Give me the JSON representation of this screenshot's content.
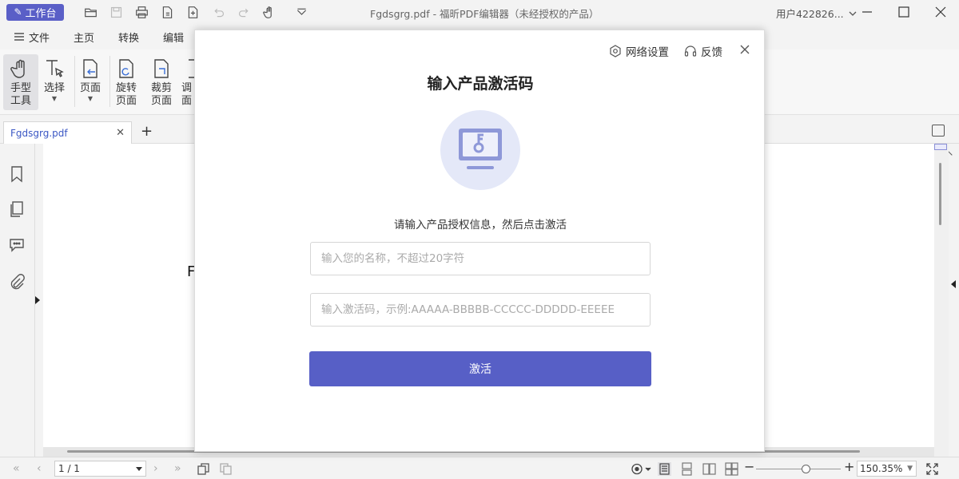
{
  "titlebar": {
    "workbench_label": "工作台",
    "window_title": "Fgdsgrg.pdf - 福昕PDF编辑器（未经授权的产品）",
    "user_label": "用户422826..."
  },
  "menu": {
    "items": [
      "文件",
      "主页",
      "转换",
      "编辑"
    ]
  },
  "ribbon": {
    "tools": [
      {
        "line1": "手型",
        "line2": "工具"
      },
      {
        "line1": "选择",
        "line2": ""
      },
      {
        "line1": "页面",
        "line2": ""
      },
      {
        "line1": "旋转",
        "line2": "页面"
      },
      {
        "line1": "裁剪",
        "line2": "页面"
      },
      {
        "line1": "调",
        "line2": "面"
      }
    ]
  },
  "tabs": {
    "doc_tab_label": "Fgdsgrg.pdf",
    "add_symbol": "+"
  },
  "document": {
    "visible_text": "F"
  },
  "statusbar": {
    "page_indicator": "1 / 1",
    "zoom_value": "150.35%"
  },
  "modal": {
    "network_settings_label": "网络设置",
    "feedback_label": "反馈",
    "title": "输入产品激活码",
    "subtitle": "请输入产品授权信息，然后点击激活",
    "name_placeholder": "输入您的名称，不超过20字符",
    "code_placeholder": "输入激活码，示例:AAAAA-BBBBB-CCCCC-DDDDD-EEEEE",
    "activate_label": "激活"
  },
  "colors": {
    "accent": "#575fc6",
    "illustration_bg": "#e4e8f8",
    "illustration_fg": "#8e98d8"
  }
}
